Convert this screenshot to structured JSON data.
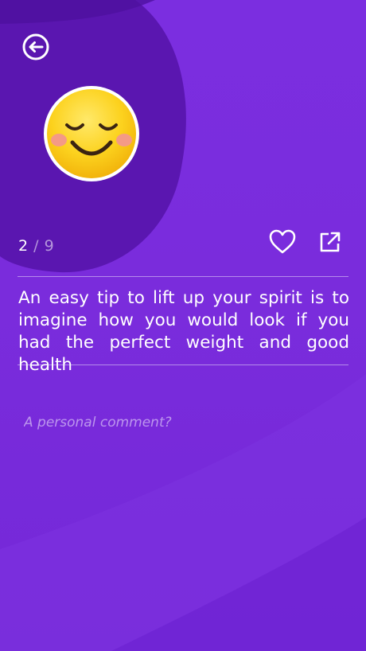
{
  "header": {
    "back_icon": "arrow-left-circle-icon"
  },
  "tip": {
    "emoji_icon": "relieved-face-emoji-icon",
    "current": "2",
    "separator": "/",
    "total": "9",
    "text": "An easy tip to lift up your spirit is to imagine how you would look if you had the perfect weight and good health"
  },
  "actions": {
    "favorite_icon": "heart-icon",
    "share_icon": "share-external-icon"
  },
  "comment": {
    "placeholder": "A personal comment?",
    "value": ""
  },
  "colors": {
    "background": "#7a2cdc",
    "blob_dark": "#5a16b0",
    "text": "#ffffff",
    "emoji_yellow": "#fcd21e",
    "emoji_blush": "#f49a86"
  }
}
